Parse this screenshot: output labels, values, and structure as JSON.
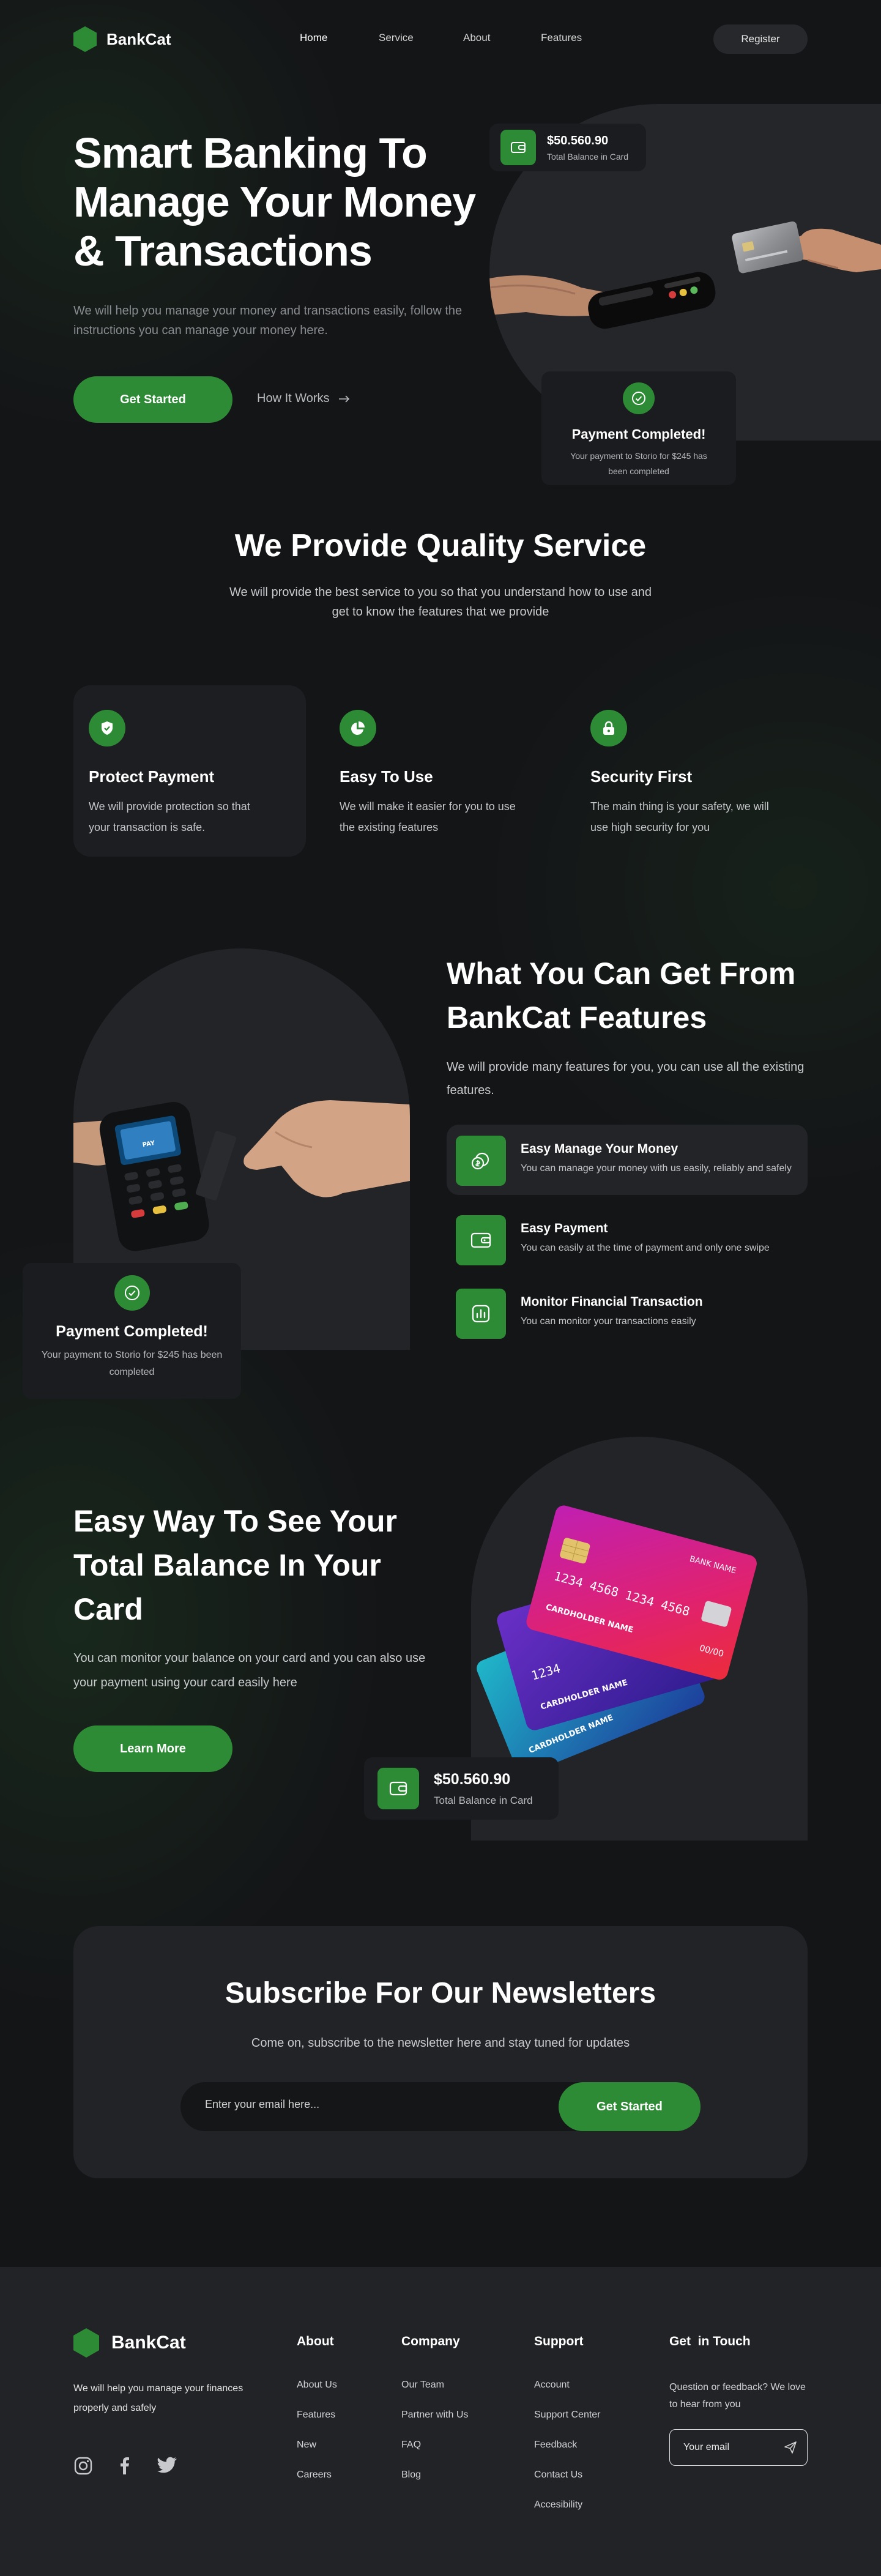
{
  "colors": {
    "accent": "#2e8b35",
    "background": "#141517",
    "panel": "#222327"
  },
  "nav": {
    "brand": "BankCat",
    "links": [
      "Home",
      "Service",
      "About",
      "Features"
    ],
    "register": "Register"
  },
  "hero": {
    "title": "Smart Banking To Manage Your Money & Transactions",
    "subtitle": "We will help you manage your money and transactions easily, follow the instructions you can manage your money here.",
    "cta": "Get Started",
    "secondary": "How It Works",
    "balance_amount": "$50.560.90",
    "balance_label": "Total Balance in Card",
    "payment_title": "Payment Completed!",
    "payment_desc": "Your payment to Storio for $245 has been completed"
  },
  "services": {
    "title": "We Provide Quality Service",
    "subtitle": "We will provide the best service to you so that you understand how to use and get to know the features that we provide",
    "items": [
      {
        "icon": "shield-icon",
        "title": "Protect Payment",
        "desc": "We will provide protection so that your transaction is safe."
      },
      {
        "icon": "pie-chart-icon",
        "title": "Easy To Use",
        "desc": "We will make it easier for you to use the existing features"
      },
      {
        "icon": "lock-icon",
        "title": "Security First",
        "desc": "The main thing is your safety, we will use high security for you"
      }
    ]
  },
  "features": {
    "title": "What You Can Get From BankCat Features",
    "subtitle": "We will provide many features for you, you can use all the existing features.",
    "payment_title": "Payment Completed!",
    "payment_desc": "Your payment to Storio for $245 has been completed",
    "pos_label": "PAY",
    "items": [
      {
        "icon": "money-icon",
        "title": "Easy Manage Your Money",
        "desc": "You can manage your money with us easily, reliably and safely"
      },
      {
        "icon": "wallet-icon",
        "title": "Easy Payment",
        "desc": "You can easily at the time of payment and only one swipe"
      },
      {
        "icon": "chart-icon",
        "title": "Monitor Financial Transaction",
        "desc": "You can monitor your transactions easily"
      }
    ]
  },
  "balance": {
    "title": "Easy Way To See Your Total Balance In Your Card",
    "subtitle": "You can monitor your balance on your card and you can also use your payment using your card easily here",
    "cta": "Learn More",
    "amount": "$50.560.90",
    "label": "Total Balance in Card",
    "card_bank": "BANK NAME",
    "card_number_front": "1234  4568 1234  4568",
    "card_number_back": "1234",
    "card_holder": "CARDHOLDER NAME",
    "card_expiry": "00/00"
  },
  "newsletter": {
    "title": "Subscribe For Our Newsletters",
    "subtitle": "Come on, subscribe to the newsletter here and stay tuned for updates",
    "placeholder": "Enter your email here...",
    "button": "Get Started"
  },
  "footer": {
    "brand": "BankCat",
    "desc": "We will help you manage your finances properly and safely",
    "columns": [
      {
        "title": "About",
        "links": [
          "About Us",
          "Features",
          "New",
          "Careers"
        ]
      },
      {
        "title": "Company",
        "links": [
          "Our Team",
          "Partner with Us",
          "FAQ",
          "Blog"
        ]
      },
      {
        "title": "Support",
        "links": [
          "Account",
          "Support Center",
          "Feedback",
          "Contact Us",
          "Accesibility"
        ]
      }
    ],
    "touch_title": "Get  in Touch",
    "touch_desc": "Question or feedback? We love to hear from you",
    "email_placeholder": "Your email"
  }
}
